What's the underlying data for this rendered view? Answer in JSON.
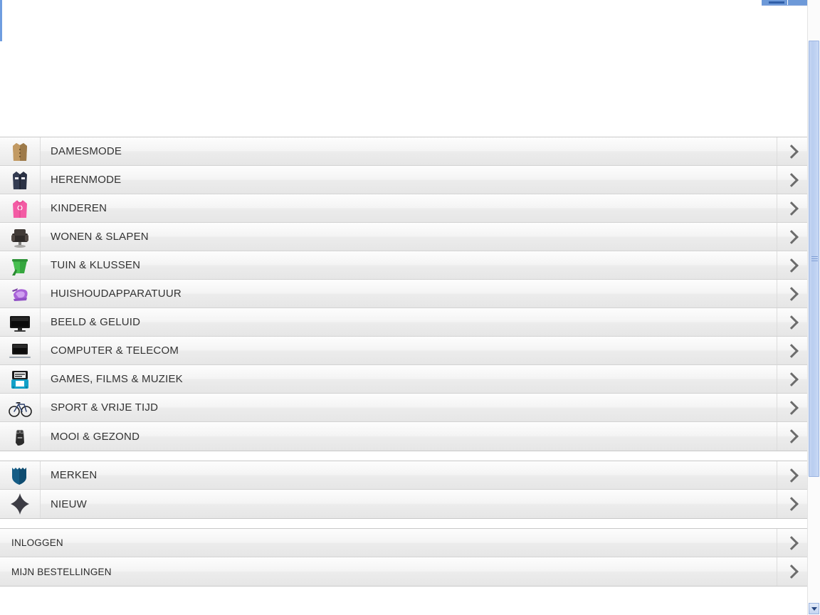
{
  "page": {
    "background_color": "#ffffff",
    "accent_color": "#6d99d8",
    "row_text_color": "#333333"
  },
  "menu": {
    "groups": [
      {
        "name": "categories",
        "rows": [
          {
            "label": "DAMESMODE",
            "icon": "womens-coat-icon",
            "has_icon": true,
            "chevron": "chevron-right-icon"
          },
          {
            "label": "HERENMODE",
            "icon": "mens-jacket-icon",
            "has_icon": true,
            "chevron": "chevron-right-icon"
          },
          {
            "label": "KINDEREN",
            "icon": "kids-pink-hoodie-icon",
            "has_icon": true,
            "chevron": "chevron-right-icon"
          },
          {
            "label": "WONEN & SLAPEN",
            "icon": "armchair-icon",
            "has_icon": true,
            "chevron": "chevron-right-icon"
          },
          {
            "label": "TUIN & KLUSSEN",
            "icon": "green-plant-pot-icon",
            "has_icon": true,
            "chevron": "chevron-right-icon"
          },
          {
            "label": "HUISHOUDAPPARATUUR",
            "icon": "purple-steam-iron-icon",
            "has_icon": true,
            "chevron": "chevron-right-icon"
          },
          {
            "label": "BEELD & GELUID",
            "icon": "television-icon",
            "has_icon": true,
            "chevron": "chevron-right-icon"
          },
          {
            "label": "COMPUTER & TELECOM",
            "icon": "laptop-icon",
            "has_icon": true,
            "chevron": "chevron-right-icon"
          },
          {
            "label": "GAMES, FILMS & MUZIEK",
            "icon": "handheld-console-icon",
            "has_icon": true,
            "chevron": "chevron-right-icon"
          },
          {
            "label": "SPORT & VRIJE TIJD",
            "icon": "bicycle-icon",
            "has_icon": true,
            "chevron": "chevron-right-icon"
          },
          {
            "label": "MOOI & GEZOND",
            "icon": "electric-shaver-icon",
            "has_icon": true,
            "chevron": "chevron-right-icon"
          }
        ]
      },
      {
        "name": "highlights",
        "rows": [
          {
            "label": "MERKEN",
            "icon": "shield-badge-icon",
            "has_icon": true,
            "chevron": "chevron-right-icon"
          },
          {
            "label": "NIEUW",
            "icon": "sparkle-star-icon",
            "has_icon": true,
            "chevron": "chevron-right-icon"
          }
        ]
      },
      {
        "name": "account",
        "rows": [
          {
            "label": "INLOGGEN",
            "icon": null,
            "has_icon": false,
            "chevron": "chevron-right-icon"
          },
          {
            "label": "MIJN BESTELLINGEN",
            "icon": null,
            "has_icon": false,
            "chevron": "chevron-right-icon"
          }
        ]
      }
    ]
  },
  "scrollbar": {
    "orientation": "vertical",
    "down_button_icon": "scroll-down-arrow-icon",
    "thumb_grip_icon": "scrollbar-grip-icon"
  }
}
